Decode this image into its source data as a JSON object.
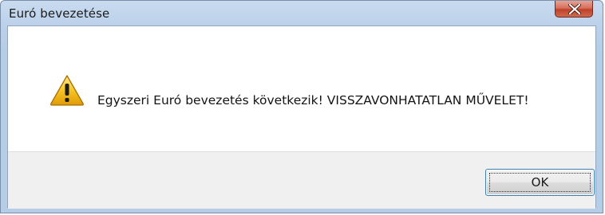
{
  "window": {
    "title": "Euró bevezetése",
    "close_icon": "close-icon"
  },
  "dialog": {
    "icon": "warning-icon",
    "message": "Egyszeri Euró bevezetés következik! VISSZAVONHATATLAN MŰVELET!",
    "ok_label": "OK"
  },
  "colors": {
    "close_button": "#c9503a",
    "warning_fill": "#f4c21c",
    "ok_border": "#3c7fb1"
  }
}
